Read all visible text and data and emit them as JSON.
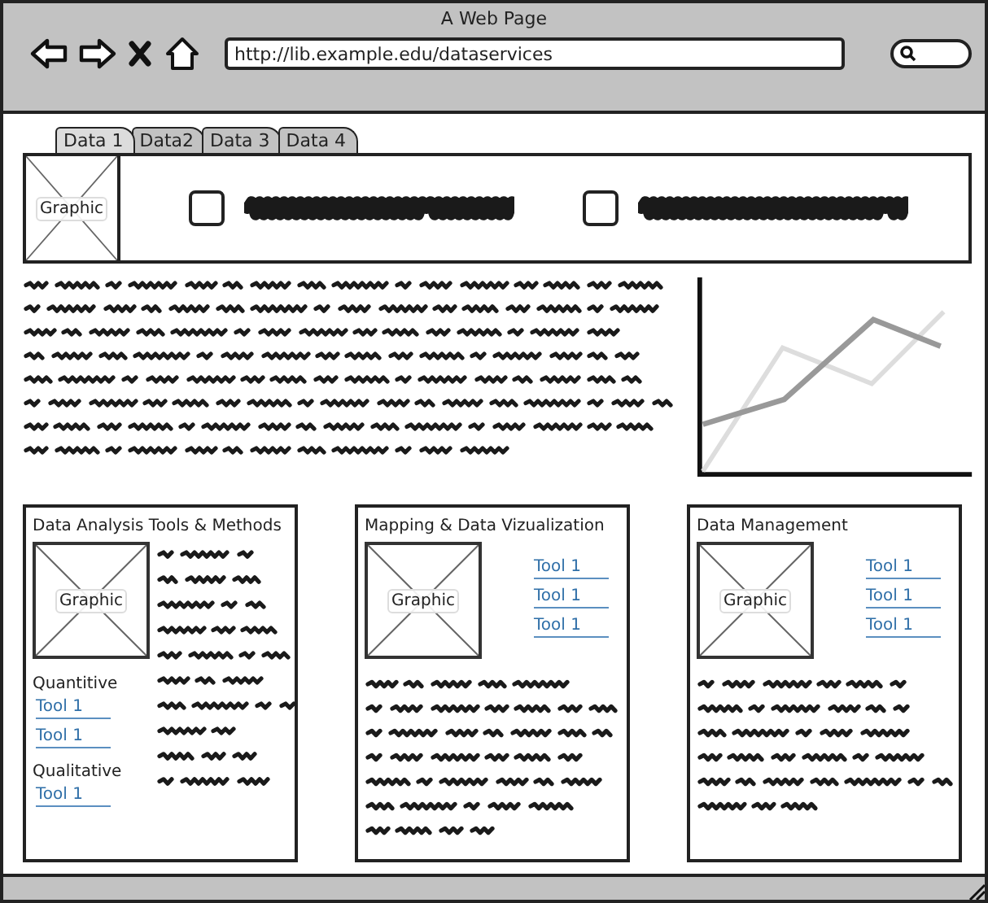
{
  "window": {
    "title": "A Web Page",
    "url": "http://lib.example.edu/dataservices"
  },
  "tabs": [
    {
      "label": "Data 1",
      "selected": true
    },
    {
      "label": "Data2",
      "selected": false
    },
    {
      "label": "Data 3",
      "selected": false
    },
    {
      "label": "Data 4",
      "selected": false
    }
  ],
  "strip": {
    "graphic_label": "Graphic",
    "checkboxes": [
      {
        "checked": false
      },
      {
        "checked": false
      }
    ]
  },
  "sections": [
    {
      "kind": "grouped",
      "title": "Data Analysis Tools & Methods",
      "graphic_label": "Graphic",
      "groups": [
        {
          "heading": "Quantitive",
          "links": [
            "Tool 1",
            "Tool 1"
          ]
        },
        {
          "heading": "Qualitative",
          "links": [
            "Tool 1"
          ]
        }
      ]
    },
    {
      "kind": "linked",
      "title": "Mapping & Data Vizualization",
      "graphic_label": "Graphic",
      "links": [
        "Tool 1",
        "Tool 1",
        "Tool 1"
      ]
    },
    {
      "kind": "linked",
      "title": "Data Management",
      "graphic_label": "Graphic",
      "links": [
        "Tool 1",
        "Tool 1",
        "Tool 1"
      ]
    }
  ]
}
